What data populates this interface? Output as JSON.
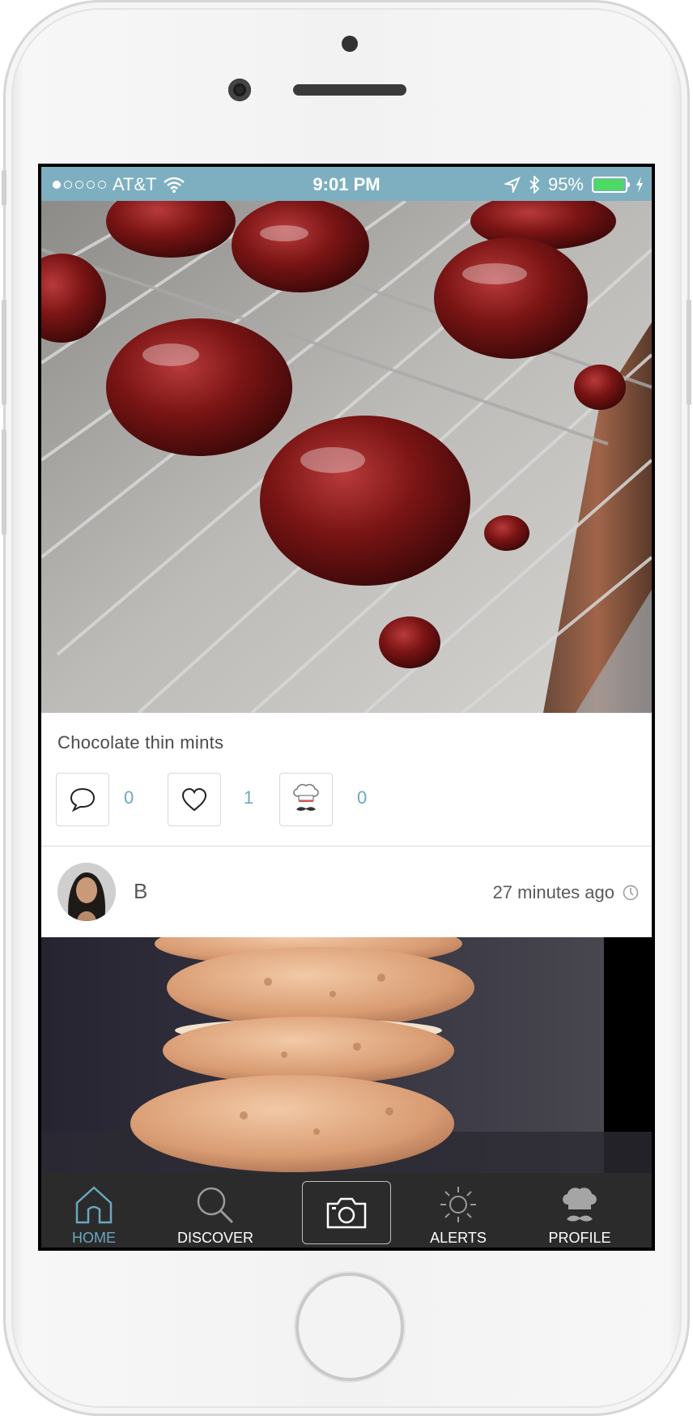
{
  "status_bar": {
    "carrier": "AT&T",
    "time": "9:01 PM",
    "battery": "95%",
    "signal_bars_filled": 1,
    "signal_bars_total": 5
  },
  "post": {
    "title": "Chocolate thin mints",
    "comment_count": "0",
    "like_count": "1",
    "chef_count": "0"
  },
  "next_post": {
    "author": "B",
    "time_ago": "27 minutes ago"
  },
  "tab_bar": {
    "home": "HOME",
    "discover": "DISCOVER",
    "alerts": "ALERTS",
    "profile": "PROFILE",
    "active_color": "#6aa8bf"
  },
  "colors": {
    "status_bar_bg": "#7dafc0",
    "accent": "#6aa8bf",
    "tab_bar_bg": "#2b2b2b"
  },
  "icons": [
    "comment-icon",
    "heart-icon",
    "chef-icon",
    "clock-icon",
    "home-icon",
    "search-icon",
    "camera-icon",
    "sun-icon",
    "chef-hat-icon",
    "wifi-icon",
    "location-icon",
    "bluetooth-icon",
    "battery-icon",
    "charging-icon"
  ]
}
